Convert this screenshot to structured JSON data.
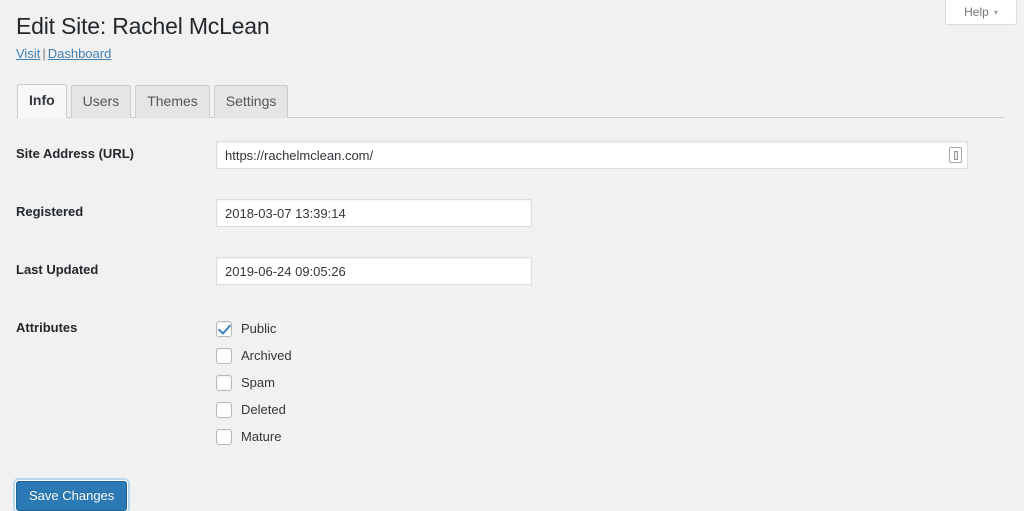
{
  "help": {
    "label": "Help",
    "caret": "▾"
  },
  "header": {
    "title": "Edit Site: Rachel McLean",
    "links": [
      {
        "label": "Visit"
      },
      {
        "label": "Dashboard"
      }
    ],
    "link_separator": "|"
  },
  "tabs": [
    {
      "label": "Info",
      "active": true
    },
    {
      "label": "Users",
      "active": false
    },
    {
      "label": "Themes",
      "active": false
    },
    {
      "label": "Settings",
      "active": false
    }
  ],
  "form": {
    "site_address": {
      "label": "Site Address (URL)",
      "value": "https://rachelmclean.com/",
      "placeholder": "",
      "icon": "password-manager-icon"
    },
    "registered": {
      "label": "Registered",
      "value": "2018-03-07 13:39:14",
      "placeholder": ""
    },
    "last_updated": {
      "label": "Last Updated",
      "value": "2019-06-24 09:05:26",
      "placeholder": ""
    },
    "attributes": {
      "label": "Attributes",
      "options": [
        {
          "label": "Public",
          "checked": true
        },
        {
          "label": "Archived",
          "checked": false
        },
        {
          "label": "Spam",
          "checked": false
        },
        {
          "label": "Deleted",
          "checked": false
        },
        {
          "label": "Mature",
          "checked": false
        }
      ]
    }
  },
  "actions": {
    "save_label": "Save Changes"
  },
  "colors": {
    "page_background": "#f1f1f1",
    "primary_button": "#2b7ab5",
    "link": "#3f7fb3",
    "checkbox_check": "#3582c4",
    "title_text": "#23282d"
  }
}
